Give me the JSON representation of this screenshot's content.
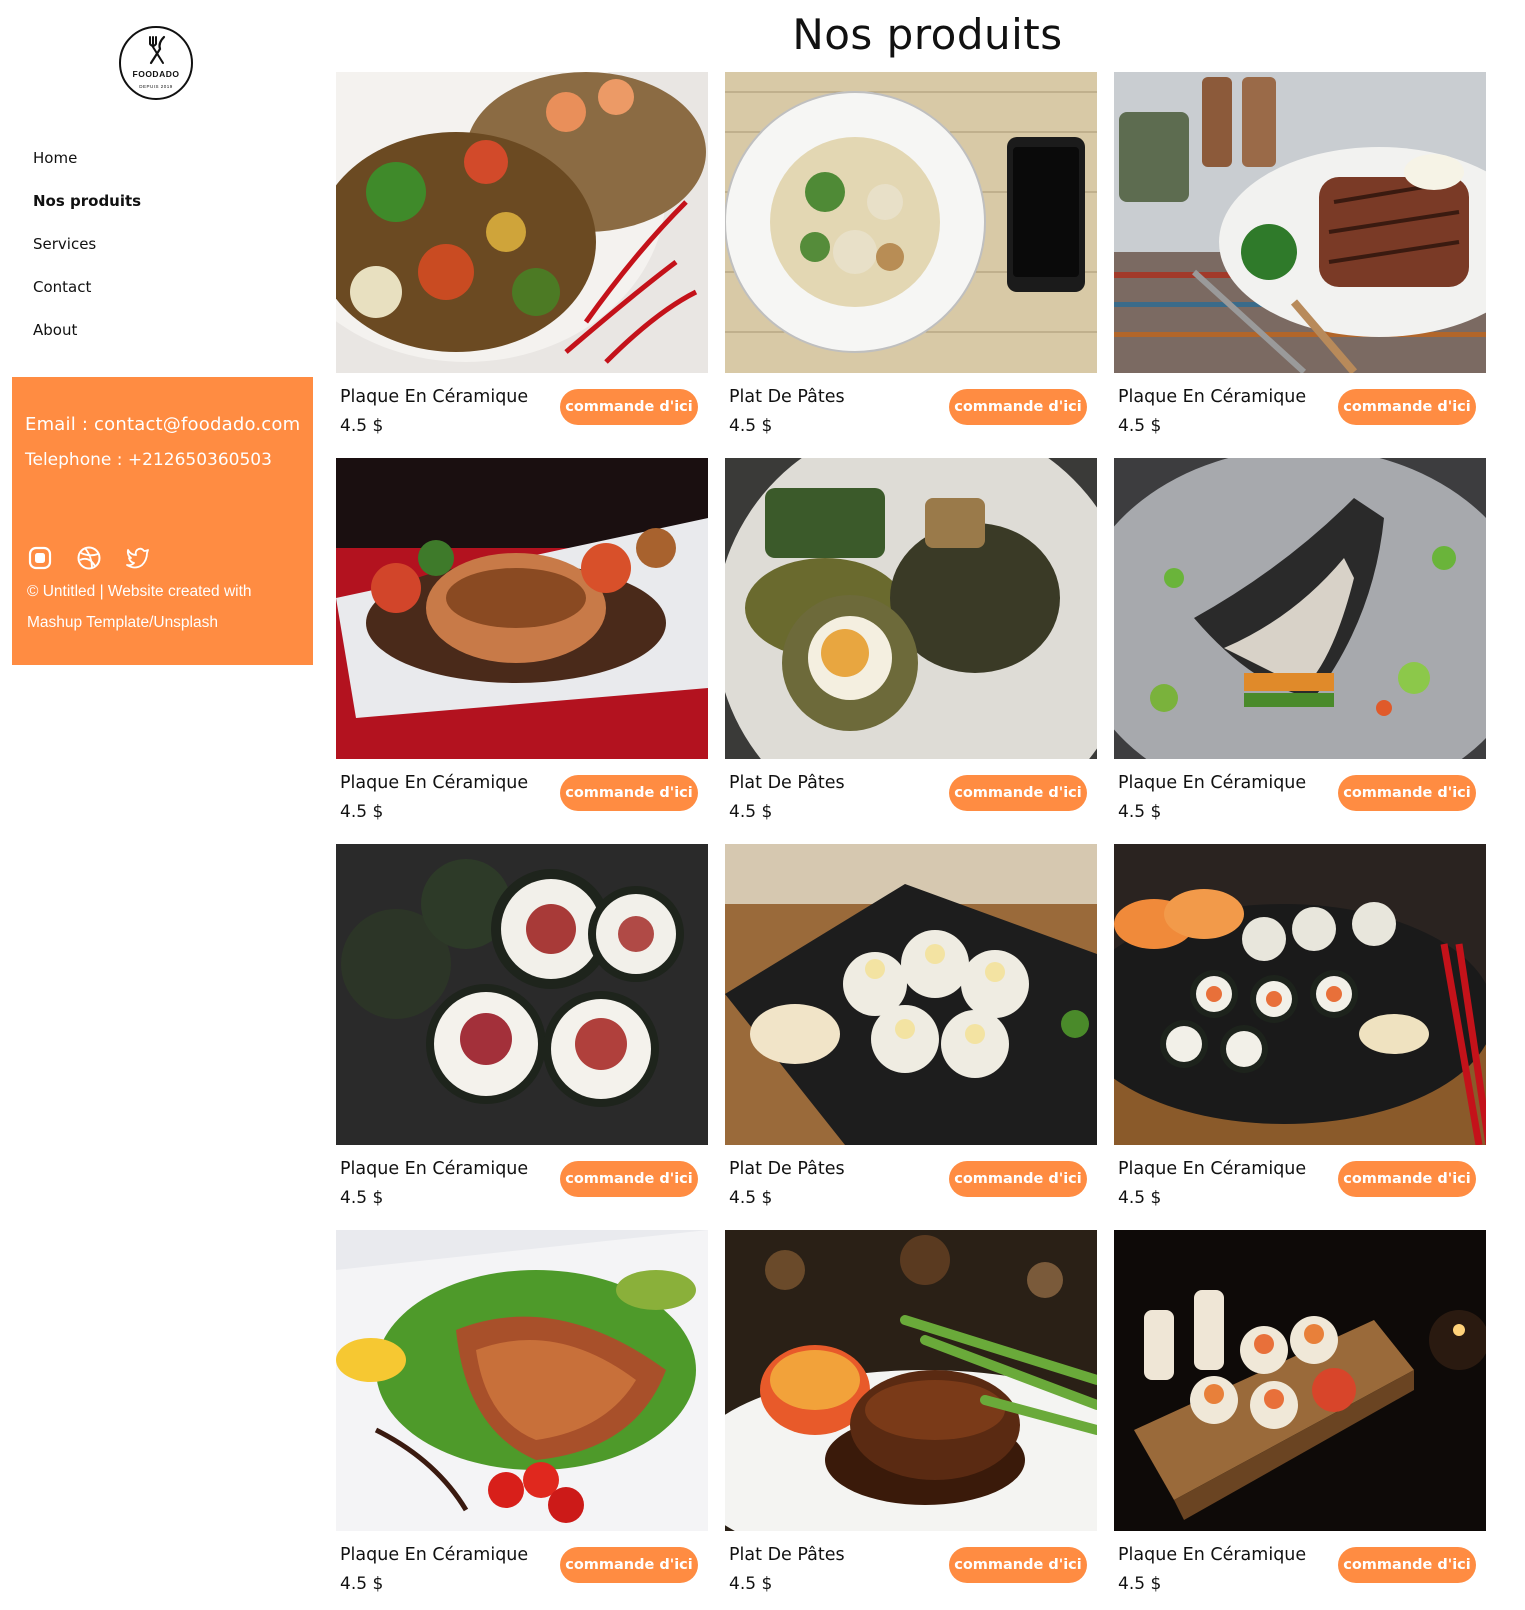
{
  "sidebar": {
    "logo": {
      "brand": "FOODADO",
      "since": "DEPUIS 2019",
      "icon": "fork-knife-icon"
    },
    "nav": [
      {
        "label": "Home",
        "active": false
      },
      {
        "label": "Nos produits",
        "active": true
      },
      {
        "label": "Services",
        "active": false
      },
      {
        "label": "Contact",
        "active": false
      },
      {
        "label": "About",
        "active": false
      }
    ],
    "contact": {
      "email": "Email : contact@foodado.com",
      "phone": "Telephone : +212650360503",
      "social_icons": [
        "instagram-icon",
        "dribbble-icon",
        "twitter-icon"
      ],
      "credit": "© Untitled | Website created with Mashup Template/Unsplash"
    }
  },
  "main": {
    "title": "Nos produits",
    "products": [
      {
        "name": "Plaque En Céramique",
        "price": "4.5 $",
        "button": "commande d'ici",
        "image": "stir-fry-shrimp-rice"
      },
      {
        "name": "Plat De Pâtes",
        "price": "4.5 $",
        "button": "commande d'ici",
        "image": "pasta-plate-newspaper-phone"
      },
      {
        "name": "Plaque En Céramique",
        "price": "4.5 $",
        "button": "commande d'ici",
        "image": "grilled-steak-plate"
      },
      {
        "name": "Plaque En Céramique",
        "price": "4.5 $",
        "button": "commande d'ici",
        "image": "salmon-fillet-red-table"
      },
      {
        "name": "Plat De Pâtes",
        "price": "4.5 $",
        "button": "commande d'ici",
        "image": "scotch-egg-plate"
      },
      {
        "name": "Plaque En Céramique",
        "price": "4.5 $",
        "button": "commande d'ici",
        "image": "grilled-fish-vegetables"
      },
      {
        "name": "Plaque En Céramique",
        "price": "4.5 $",
        "button": "commande d'ici",
        "image": "tuna-maki-rolls"
      },
      {
        "name": "Plat De Pâtes",
        "price": "4.5 $",
        "button": "commande d'ici",
        "image": "california-rolls-black-plate"
      },
      {
        "name": "Plaque En Céramique",
        "price": "4.5 $",
        "button": "commande d'ici",
        "image": "sushi-platter-chopsticks"
      },
      {
        "name": "Plaque En Céramique",
        "price": "4.5 $",
        "button": "commande d'ici",
        "image": "salmon-steak-salad"
      },
      {
        "name": "Plat De Pâtes",
        "price": "4.5 $",
        "button": "commande d'ici",
        "image": "steak-asparagus"
      },
      {
        "name": "Plaque En Céramique",
        "price": "4.5 $",
        "button": "commande d'ici",
        "image": "sushi-wooden-board"
      }
    ]
  },
  "colors": {
    "accent": "#ff8c42",
    "text": "#111111",
    "background": "#ffffff"
  }
}
